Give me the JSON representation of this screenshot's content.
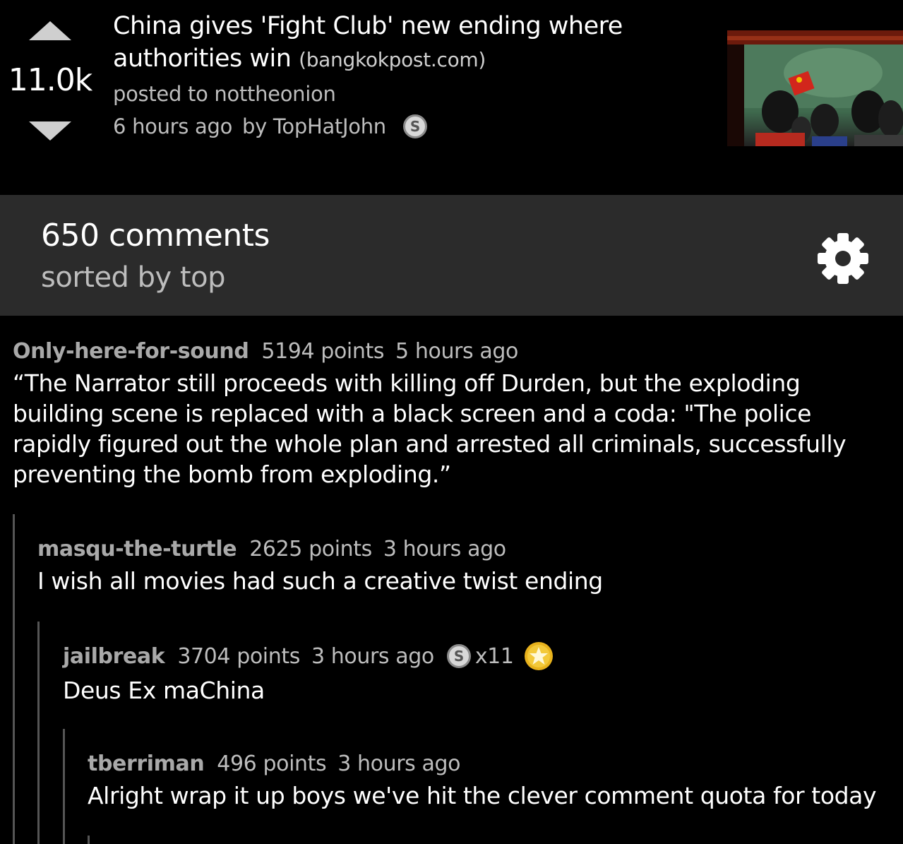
{
  "post": {
    "score": "11.0k",
    "title": "China gives 'Fight Club' new ending where authorities win",
    "domain": "(bangkokpost.com)",
    "posted_to": "posted to nottheonion",
    "time": "6 hours ago",
    "author": "by TopHatJohn"
  },
  "comments_bar": {
    "count": "650 comments",
    "sort": "sorted by top"
  },
  "comments": [
    {
      "author": "Only-here-for-sound",
      "points": "5194 points",
      "time": "5 hours ago",
      "text": "“The Narrator still proceeds with killing off Durden, but the exploding building scene is replaced with a black screen and a coda: \"The police rapidly figured out the whole plan and arrested all criminals, successfully preventing the bomb from exploding.”"
    },
    {
      "author": "masqu-the-turtle",
      "points": "2625 points",
      "time": "3 hours ago",
      "text": "I wish all movies had such a creative twist ending"
    },
    {
      "author": "jailbreak",
      "points": "3704 points",
      "time": "3 hours ago",
      "silver_count": "x11",
      "text": "Deus Ex maChina"
    },
    {
      "author": "tberriman",
      "points": "496 points",
      "time": "3 hours ago",
      "text": "Alright wrap it up boys we've hit the clever comment quota for today"
    }
  ],
  "icons": {
    "upvote": "arrow-up-icon",
    "downvote": "arrow-down-icon",
    "silver": "silver-award-icon",
    "gold": "gold-award-icon",
    "settings": "gear-icon"
  },
  "colors": {
    "background": "#000000",
    "bar": "#2b2b2b",
    "meta_text": "#bdbdbd",
    "thread_line": "#555555"
  }
}
